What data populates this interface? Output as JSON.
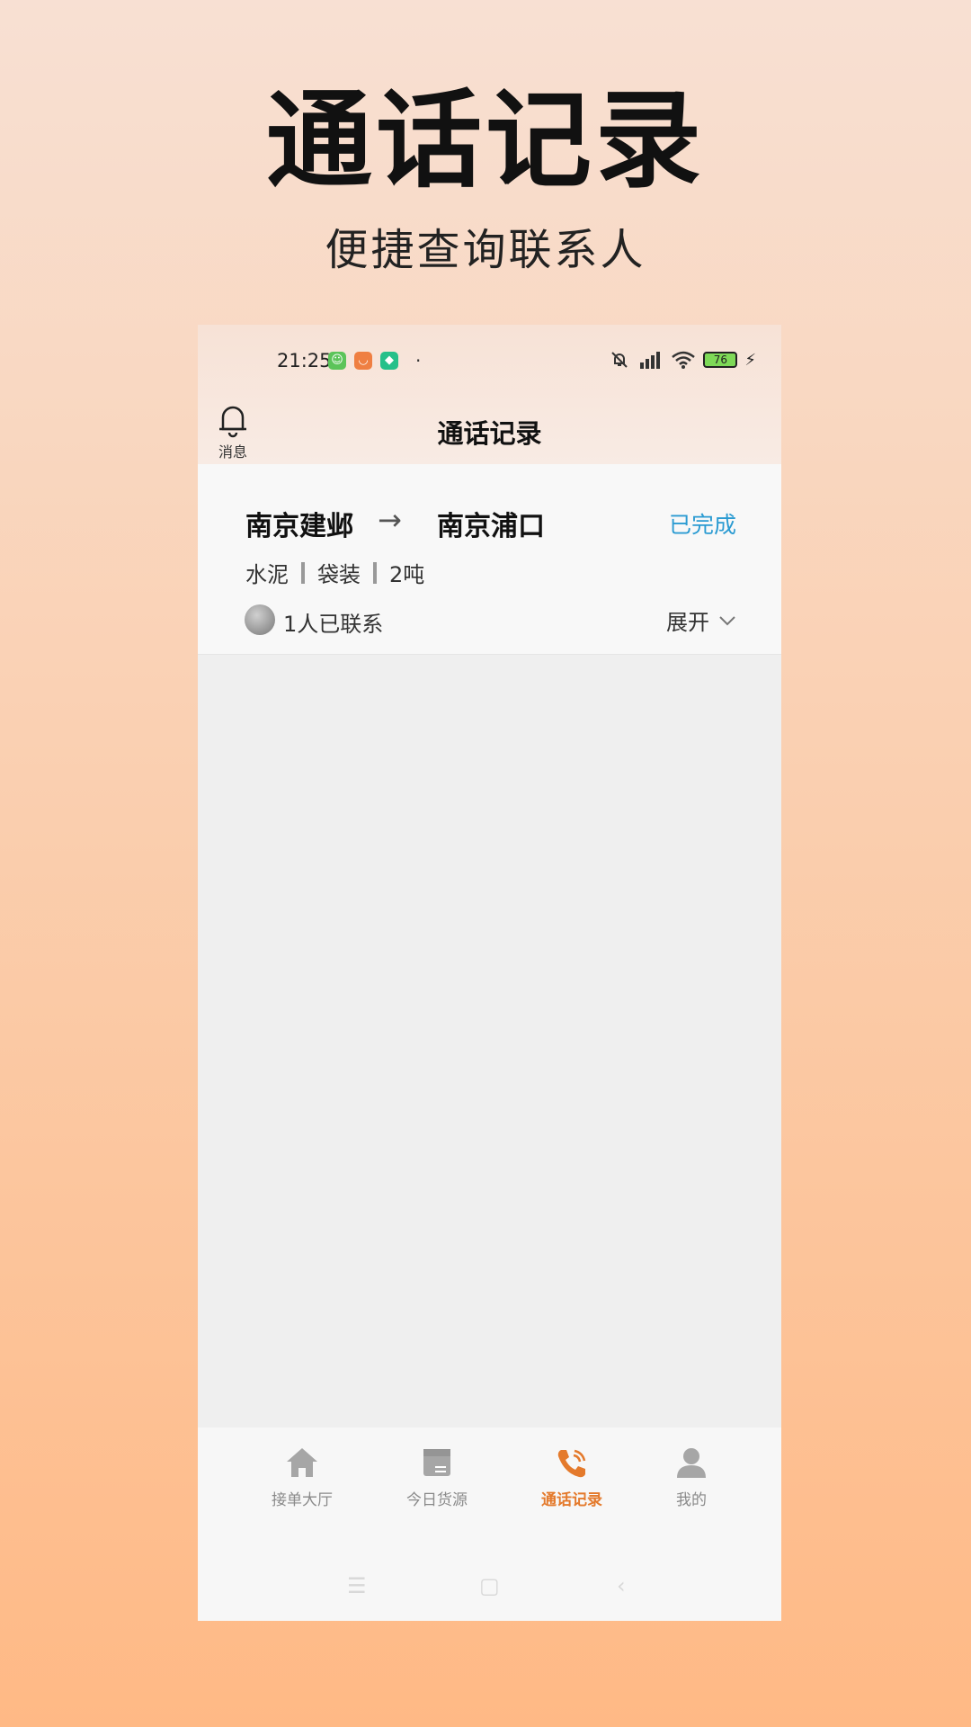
{
  "promo": {
    "title": "通话记录",
    "subtitle": "便捷查询联系人"
  },
  "status_bar": {
    "time": "21:25",
    "battery": "76"
  },
  "header": {
    "bell_label": "消息",
    "title": "通话记录"
  },
  "records": [
    {
      "from": "南京建邺",
      "arrow": "→",
      "to": "南京浦口",
      "status": "已完成",
      "cargo": [
        "水泥",
        "袋装",
        "2吨"
      ],
      "contacts": "1人已联系",
      "expand_label": "展开"
    }
  ],
  "tabbar": {
    "items": [
      {
        "label": "接单大厅",
        "icon": "home-icon"
      },
      {
        "label": "今日货源",
        "icon": "box-icon"
      },
      {
        "label": "通话记录",
        "icon": "phone-icon",
        "active": true
      },
      {
        "label": "我的",
        "icon": "user-icon"
      }
    ]
  },
  "colors": {
    "accent": "#e47a2c",
    "status_done": "#2b9bd2"
  }
}
